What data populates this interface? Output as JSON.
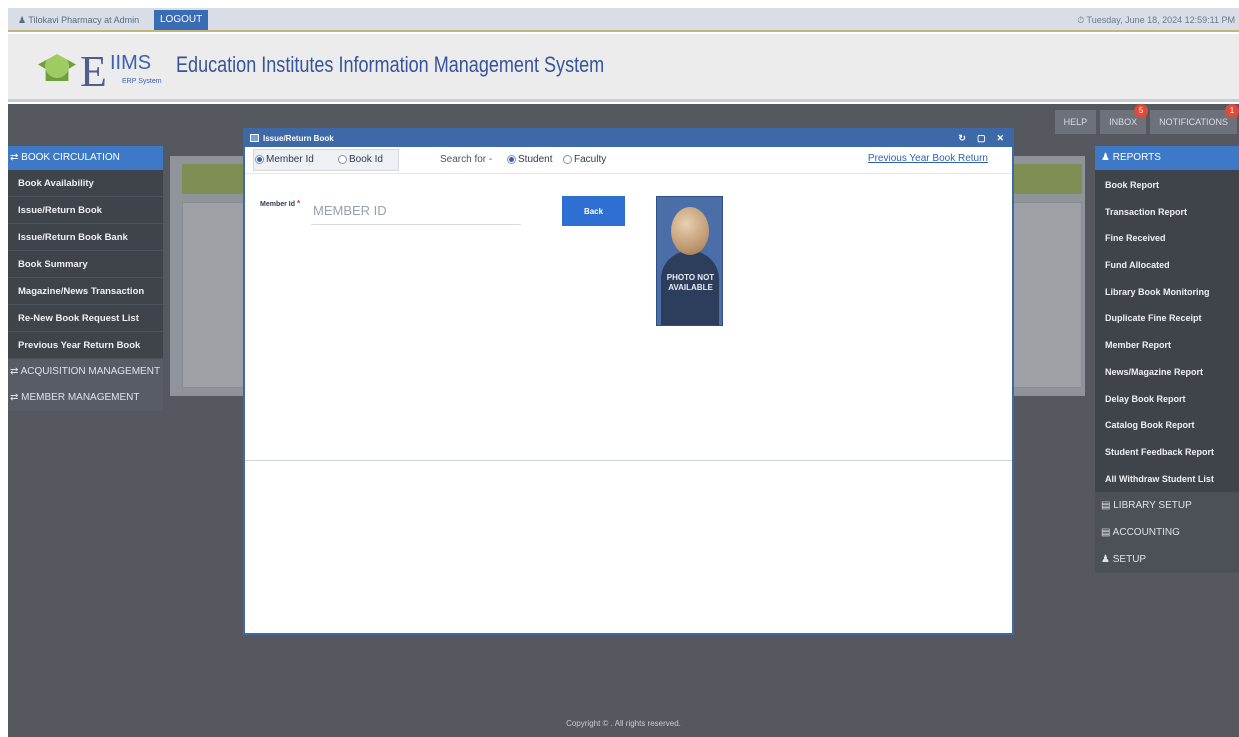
{
  "userbar": {
    "user_text": "♟ Tilokavi Pharmacy  at Admin",
    "logout_label": "LOGOUT",
    "datetime": "⏱ Tuesday, June 18, 2024  12:59:11 PM"
  },
  "header": {
    "logo_e": "E",
    "logo_iims": "IIMS",
    "logo_sub": "ERP System",
    "system_name": "Education Institutes Information Management System"
  },
  "topnav": {
    "help": "HELP",
    "inbox": "INBOX",
    "inbox_badge": "5",
    "notifications": "NOTIFICATIONS",
    "notifications_badge": "1"
  },
  "left_sidebar": {
    "section": "⇄ BOOK CIRCULATION",
    "items": [
      "Book Availability",
      "Issue/Return Book",
      "Issue/Return Book Bank",
      "Book Summary",
      "Magazine/News Transaction",
      "Re-New Book Request List",
      "Previous Year Return Book"
    ],
    "group1": "⇄ ACQUISITION MANAGEMENT",
    "group2": "⇄ MEMBER MANAGEMENT"
  },
  "right_sidebar": {
    "section": "♟ REPORTS",
    "items": [
      "Book Report",
      "Transaction Report",
      "Fine Received",
      "Fund Allocated",
      "Library Book Monitoring",
      "Duplicate Fine Receipt",
      "Member Report",
      "News/Magazine Report",
      "Delay Book Report",
      "Catalog Book Report",
      "Student Feedback Report",
      "All Withdraw Student List"
    ],
    "groups": [
      "▤ LIBRARY SETUP",
      "▤ ACCOUNTING",
      "♟ SETUP"
    ]
  },
  "modal": {
    "title": "Issue/Return Book",
    "ctrl_refresh": "↻",
    "ctrl_max": "▢",
    "ctrl_close": "✕",
    "radio_member": "Member Id",
    "radio_book": "Book Id",
    "search_for": "Search for -",
    "radio_student": "Student",
    "radio_faculty": "Faculty",
    "selected_id_type": "Member Id",
    "selected_search": "Student",
    "prev_link": "Previous Year Book Return",
    "member_label": "Member Id",
    "member_placeholder": "MEMBER ID",
    "back_label": "Back",
    "photo_text": "PHOTO NOT AVAILABLE"
  },
  "footer": {
    "text": "Copyright © . All rights reserved."
  },
  "colors": {
    "accent": "#3e69a8",
    "sidebar_head": "#3d79c7",
    "button": "#2f6fd1",
    "badge": "#e04a3a"
  }
}
